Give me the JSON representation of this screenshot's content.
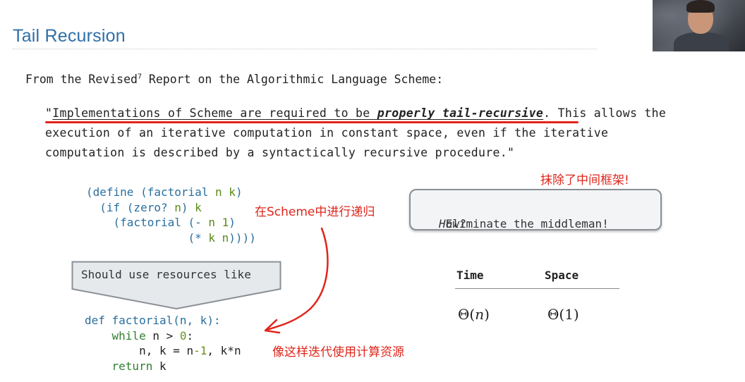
{
  "slide": {
    "title": "Tail Recursion",
    "intro_pre": "From the Revised",
    "intro_sup": "7",
    "intro_post": " Report on the Algorithmic Language Scheme:",
    "quote": {
      "open": "\"",
      "underlined": "Implementations of Scheme are required to be ",
      "emphasis": "properly tail-recursive",
      "line1_rest": ". This allows the",
      "line2": "execution of an iterative computation in constant space, even if the iterative",
      "line3": "computation is described by a syntactically recursive procedure.\""
    },
    "scheme_code": {
      "l1a": "(define (factorial ",
      "l1b": "n k",
      "l1c": ")",
      "l2a": "  (if (zero? ",
      "l2b": "n",
      "l2c": ") ",
      "l2d": "k",
      "l3a": "    (factorial (- ",
      "l3b": "n 1",
      "l3c": ")",
      "l4a": "               (* ",
      "l4b": "k n",
      "l4c": "))))"
    },
    "arrow_box_label": "Should use resources like",
    "python_code": {
      "l1": "def factorial(n, k):",
      "l2a": "    ",
      "l2b": "while",
      "l2c": " n > ",
      "l2d": "0",
      "l2e": ":",
      "l3a": "        n, k = n",
      "l3b": "-1",
      "l3c": ", k",
      "l3d": "*",
      "l3e": "n",
      "l4a": "    ",
      "l4b": "return",
      "l4c": " k"
    },
    "callout": {
      "italic": "How?",
      "text": " Eliminate the middleman!"
    },
    "table": {
      "headers": [
        "Time",
        "Space"
      ],
      "time_theta": "Θ(",
      "time_var": "n",
      "time_close": ")",
      "space_value": "Θ(1)"
    }
  },
  "annotations": {
    "note_top_right": "抹除了中间框架!",
    "note_middle": "在Scheme中进行递归",
    "note_bottom": "像这样迭代使用计算资源",
    "color": "#e0251b"
  },
  "theme": {
    "title_color": "#2f6fa8",
    "code_blue": "#2a6f9e",
    "code_green": "#5a8a1a"
  },
  "webcam": {
    "icon": "presenter-webcam"
  }
}
